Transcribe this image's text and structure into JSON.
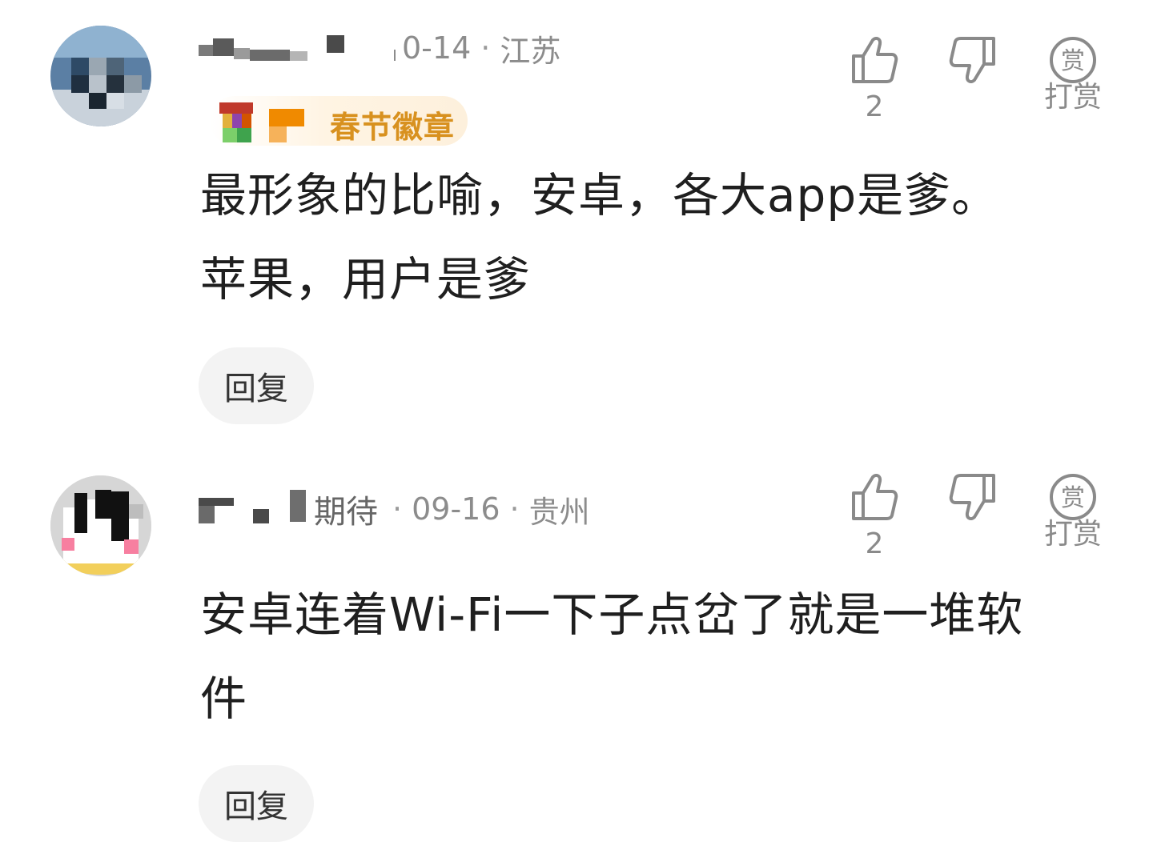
{
  "comments": [
    {
      "username_masked": true,
      "date": "0-14",
      "location": "江苏",
      "badge_label": "春节徽章",
      "text_lines": [
        "最形象的比喻，安卓，各大app是爹。",
        "苹果，用户是爹"
      ],
      "reply_label": "回复",
      "like_count": "2",
      "tip_label": "打赏",
      "tip_icon_char": "赏"
    },
    {
      "username_masked": true,
      "username_visible": "期待",
      "date": "09-16",
      "location": "贵州",
      "text_lines": [
        "安卓连着Wi-Fi一下子点岔了就是一堆软",
        "件"
      ],
      "reply_label": "回复",
      "like_count": "2",
      "tip_label": "打赏",
      "tip_icon_char": "赏"
    }
  ],
  "separator": "·",
  "icons": {
    "like": "thumbs-up-outline",
    "dislike": "thumbs-down-outline",
    "tip": "circled-reward"
  },
  "colors": {
    "meta_text": "#8c8c8c",
    "badge_text": "#d8911f",
    "reply_bg": "#f3f3f3"
  }
}
